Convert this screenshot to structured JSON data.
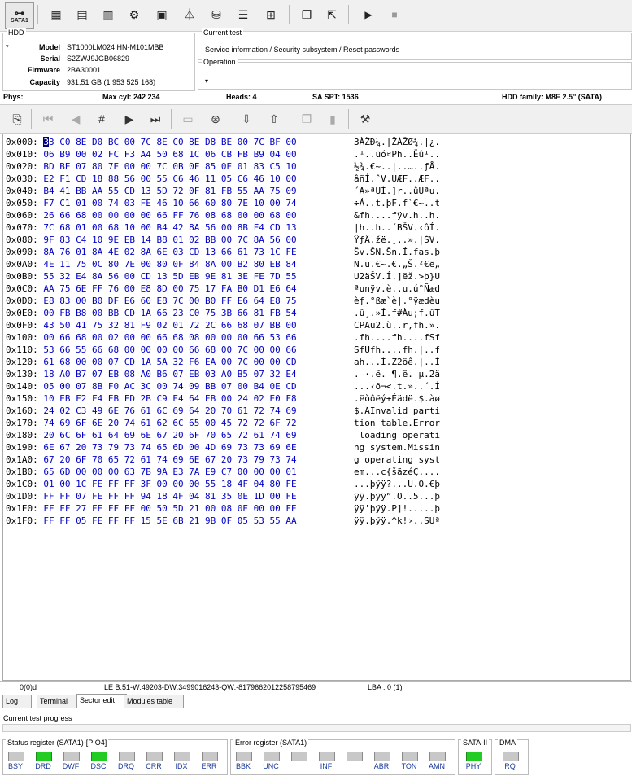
{
  "toolbar": {
    "sata_label": "SATA1"
  },
  "hdd": {
    "legend": "HDD",
    "model_label": "Model",
    "model": "ST1000LM024 HN-M101MBB",
    "serial_label": "Serial",
    "serial": "S2ZWJ9JGB06829",
    "firmware_label": "Firmware",
    "firmware": "2BA30001",
    "capacity_label": "Capacity",
    "capacity": "931,51 GB (1 953 525 168)"
  },
  "current_test": {
    "legend": "Current test",
    "value": "Service information / Security subsystem / Reset passwords"
  },
  "operation": {
    "legend": "Operation",
    "value": ""
  },
  "phys": {
    "label": "Phys:",
    "max_cyl": "Max cyl: 242 234",
    "heads": "Heads: 4",
    "sa_spt": "SA SPT: 1536",
    "family": "HDD family: M8E 2.5'' (SATA)"
  },
  "hex_rows": [
    {
      "off": "0x000:",
      "hex": "33 C0 8E D0 BC 00 7C 8E C0 8E D8 BE 00 7C BF 00",
      "asc": "3ÀŽÐ¼.|ŽÀŽØ¾.|¿."
    },
    {
      "off": "0x010:",
      "hex": "06 B9 00 02 FC F3 A4 50 68 1C 06 CB FB B9 04 00",
      "asc": ".¹..üó¤Ph..Ëû¹.."
    },
    {
      "off": "0x020:",
      "hex": "BD BE 07 80 7E 00 00 7C 0B 0F 85 0E 01 83 C5 10",
      "asc": "½¾.€~..|..…..ƒÅ."
    },
    {
      "off": "0x030:",
      "hex": "E2 F1 CD 18 88 56 00 55 C6 46 11 05 C6 46 10 00",
      "asc": "âñÍ.ˆV.UÆF..ÆF.."
    },
    {
      "off": "0x040:",
      "hex": "B4 41 BB AA 55 CD 13 5D 72 0F 81 FB 55 AA 75 09",
      "asc": "´A»ªUÍ.]r..ûUªu."
    },
    {
      "off": "0x050:",
      "hex": "F7 C1 01 00 74 03 FE 46 10 66 60 80 7E 10 00 74",
      "asc": "÷Á..t.þF.f`€~..t"
    },
    {
      "off": "0x060:",
      "hex": "26 66 68 00 00 00 00 66 FF 76 08 68 00 00 68 00",
      "asc": "&fh....fÿv.h..h."
    },
    {
      "off": "0x070:",
      "hex": "7C 68 01 00 68 10 00 B4 42 8A 56 00 8B F4 CD 13",
      "asc": "|h..h..´BŠV.‹ôÍ."
    },
    {
      "off": "0x080:",
      "hex": "9F 83 C4 10 9E EB 14 B8 01 02 BB 00 7C 8A 56 00",
      "asc": "ŸƒÄ.žë.¸..».|ŠV."
    },
    {
      "off": "0x090:",
      "hex": "8A 76 01 8A 4E 02 8A 6E 03 CD 13 66 61 73 1C FE",
      "asc": "Šv.ŠN.Šn.Í.fas.þ"
    },
    {
      "off": "0x0A0:",
      "hex": "4E 11 75 0C 80 7E 00 80 0F 84 8A 00 B2 80 EB 84",
      "asc": "N.u.€~.€.„Š.²€ë„"
    },
    {
      "off": "0x0B0:",
      "hex": "55 32 E4 8A 56 00 CD 13 5D EB 9E 81 3E FE 7D 55",
      "asc": "U2äŠV.Í.]ëž.>þ}U"
    },
    {
      "off": "0x0C0:",
      "hex": "AA 75 6E FF 76 00 E8 8D 00 75 17 FA B0 D1 E6 64",
      "asc": "ªunÿv.è..u.ú°Ñæd"
    },
    {
      "off": "0x0D0:",
      "hex": "E8 83 00 B0 DF E6 60 E8 7C 00 B0 FF E6 64 E8 75",
      "asc": "èƒ.°ßæ`è|.°ÿædèu"
    },
    {
      "off": "0x0E0:",
      "hex": "00 FB B8 00 BB CD 1A 66 23 C0 75 3B 66 81 FB 54",
      "asc": ".û¸.»Í.f#Àu;f.ûT"
    },
    {
      "off": "0x0F0:",
      "hex": "43 50 41 75 32 81 F9 02 01 72 2C 66 68 07 BB 00",
      "asc": "CPAu2.ù..r,fh.»."
    },
    {
      "off": "0x100:",
      "hex": "00 66 68 00 02 00 00 66 68 08 00 00 00 66 53 66",
      "asc": ".fh....fh....fSf"
    },
    {
      "off": "0x110:",
      "hex": "53 66 55 66 68 00 00 00 00 66 68 00 7C 00 00 66",
      "asc": "SfUfh....fh.|..f"
    },
    {
      "off": "0x120:",
      "hex": "61 68 00 00 07 CD 1A 5A 32 F6 EA 00 7C 00 00 CD",
      "asc": "ah...Í.Z2öê.|..Í"
    },
    {
      "off": "0x130:",
      "hex": "18 A0 B7 07 EB 08 A0 B6 07 EB 03 A0 B5 07 32 E4",
      "asc": ". ·.ë. ¶.ë. µ.2ä"
    },
    {
      "off": "0x140:",
      "hex": "05 00 07 8B F0 AC 3C 00 74 09 BB 07 00 B4 0E CD",
      "asc": "...‹ð¬<.t.»..´.Í"
    },
    {
      "off": "0x150:",
      "hex": "10 EB F2 F4 EB FD 2B C9 E4 64 EB 00 24 02 E0 F8",
      "asc": ".ëòôëý+Éädë.$.àø"
    },
    {
      "off": "0x160:",
      "hex": "24 02 C3 49 6E 76 61 6C 69 64 20 70 61 72 74 69",
      "asc": "$.ÃInvalid parti"
    },
    {
      "off": "0x170:",
      "hex": "74 69 6F 6E 20 74 61 62 6C 65 00 45 72 72 6F 72",
      "asc": "tion table.Error"
    },
    {
      "off": "0x180:",
      "hex": "20 6C 6F 61 64 69 6E 67 20 6F 70 65 72 61 74 69",
      "asc": " loading operati"
    },
    {
      "off": "0x190:",
      "hex": "6E 67 20 73 79 73 74 65 6D 00 4D 69 73 73 69 6E",
      "asc": "ng system.Missin"
    },
    {
      "off": "0x1A0:",
      "hex": "67 20 6F 70 65 72 61 74 69 6E 67 20 73 79 73 74",
      "asc": "g operating syst"
    },
    {
      "off": "0x1B0:",
      "hex": "65 6D 00 00 00 63 7B 9A E3 7A E9 C7 00 00 00 01",
      "asc": "em...c{šãzéÇ...."
    },
    {
      "off": "0x1C0:",
      "hex": "01 00 1C FE FF FF 3F 00 00 00 55 18 4F 04 80 FE",
      "asc": "...þÿÿ?...U.O.€þ"
    },
    {
      "off": "0x1D0:",
      "hex": "FF FF 07 FE FF FF 94 18 4F 04 81 35 0E 1D 00 FE",
      "asc": "ÿÿ.þÿÿ”.O..5...þ"
    },
    {
      "off": "0x1E0:",
      "hex": "FF FF 27 FE FF FF 00 50 5D 21 00 08 0E 00 00 FE",
      "asc": "ÿÿ'þÿÿ.P]!.....þ"
    },
    {
      "off": "0x1F0:",
      "hex": "FF FF 05 FE FF FF 15 5E 6B 21 9B 0F 05 53 55 AA",
      "asc": "ÿÿ.þÿÿ.^k!›..SUª"
    }
  ],
  "status_line": {
    "pos": "0(0)d",
    "le": "LE B:51-W:49203-DW:3499016243-QW:-8179662012258795469",
    "lba": "LBA : 0 (1)"
  },
  "tabs": [
    "Log",
    "Terminal",
    "Sector edit",
    "Modules table"
  ],
  "progress_label": "Current test progress",
  "status_register": {
    "title": "Status register (SATA1)-[PIO4]",
    "bits": [
      {
        "name": "BSY",
        "on": false
      },
      {
        "name": "DRD",
        "on": true
      },
      {
        "name": "DWF",
        "on": false
      },
      {
        "name": "DSC",
        "on": true
      },
      {
        "name": "DRQ",
        "on": false
      },
      {
        "name": "CRR",
        "on": false
      },
      {
        "name": "IDX",
        "on": false
      },
      {
        "name": "ERR",
        "on": false
      }
    ]
  },
  "error_register": {
    "title": "Error register (SATA1)",
    "bits": [
      {
        "name": "BBK",
        "on": false
      },
      {
        "name": "UNC",
        "on": false
      },
      {
        "name": "",
        "on": false
      },
      {
        "name": "INF",
        "on": false
      },
      {
        "name": "",
        "on": false
      },
      {
        "name": "ABR",
        "on": false
      },
      {
        "name": "TON",
        "on": false
      },
      {
        "name": "AMN",
        "on": false
      }
    ]
  },
  "sata2": {
    "title": "SATA-II",
    "bit": "PHY",
    "on": true
  },
  "dma": {
    "title": "DMA",
    "bit": "RQ",
    "on": false
  },
  "colors": {
    "led_on": "#22cc22",
    "led_off": "#c8c8c8",
    "hex_text": "#0000c8",
    "reg_label": "#1a3a9a"
  }
}
